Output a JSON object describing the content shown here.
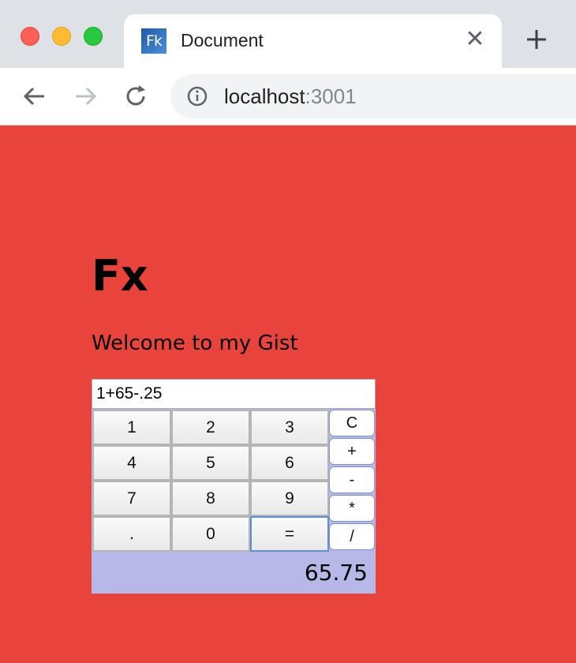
{
  "browser": {
    "tab_title": "Document",
    "favicon_text": "Fk",
    "close_glyph": "✕",
    "url_host": "localhost",
    "url_port": ":3001"
  },
  "page": {
    "title": "Fx",
    "welcome": "Welcome to my Gist"
  },
  "calculator": {
    "display_value": "1+65-.25",
    "keys": [
      "1",
      "2",
      "3",
      "4",
      "5",
      "6",
      "7",
      "8",
      "9",
      ".",
      "0",
      "="
    ],
    "operators": [
      "C",
      "+",
      "-",
      "*",
      "/"
    ],
    "result": "65.75"
  },
  "colors": {
    "page_background": "#e8443c",
    "calc_background": "#b8b8e8"
  }
}
